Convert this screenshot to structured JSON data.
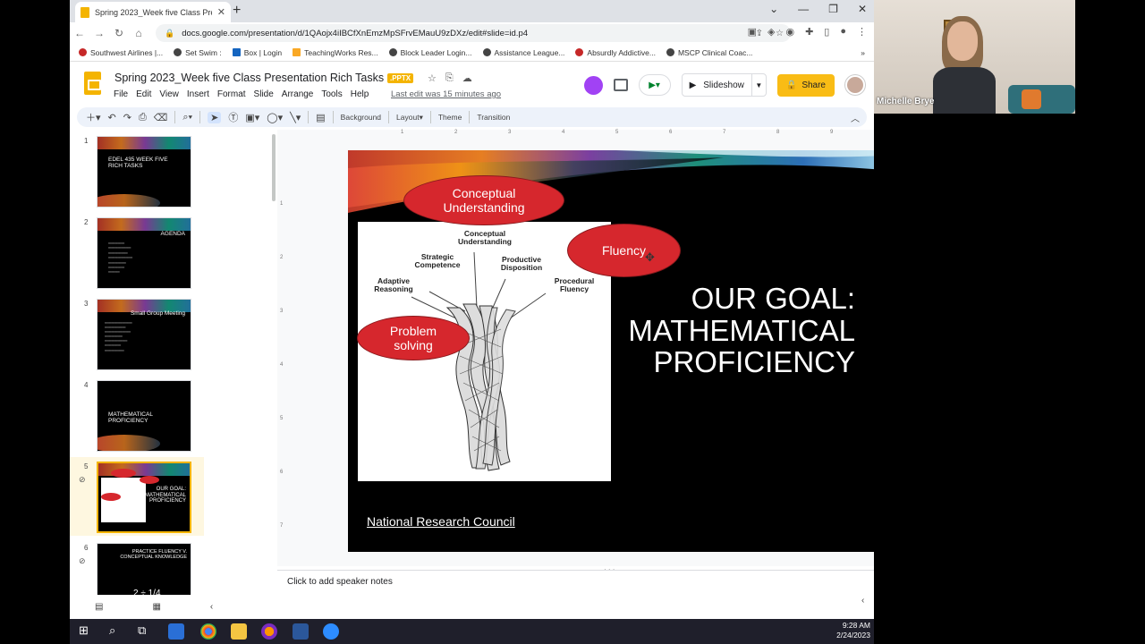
{
  "browser": {
    "tab_title": "Spring 2023_Week five Class Pre",
    "url": "docs.google.com/presentation/d/1QAojx4iIBCfXnEmzMpSFrvEMauU9zDXz/edit#slide=id.p4",
    "bookmarks": [
      {
        "label": "Southwest Airlines |...",
        "icon": "heart-icon"
      },
      {
        "label": "Set Swim :",
        "icon": "globe-icon"
      },
      {
        "label": "Box | Login",
        "icon": "box-icon"
      },
      {
        "label": "TeachingWorks Res...",
        "icon": "folder-icon"
      },
      {
        "label": "Block Leader Login...",
        "icon": "globe-icon"
      },
      {
        "label": "Assistance League...",
        "icon": "globe-icon"
      },
      {
        "label": "Absurdly Addictive...",
        "icon": "pinterest-icon"
      },
      {
        "label": "MSCP Clinical Coac...",
        "icon": "globe-icon"
      }
    ]
  },
  "app": {
    "doc_title": "Spring 2023_Week five Class Presentation Rich Tasks",
    "badge": ".PPTX",
    "menu": [
      "File",
      "Edit",
      "View",
      "Insert",
      "Format",
      "Slide",
      "Arrange",
      "Tools",
      "Help"
    ],
    "last_edit": "Last edit was 15 minutes ago",
    "slideshow_label": "Slideshow",
    "share_label": "Share"
  },
  "toolbar": {
    "background": "Background",
    "layout": "Layout",
    "theme": "Theme",
    "transition": "Transition"
  },
  "filmstrip": [
    {
      "num": "1",
      "title": "EDEL 435 WEEK FIVE RICH TASKS"
    },
    {
      "num": "2",
      "title": "AGENDA"
    },
    {
      "num": "3",
      "title": "Small Group Meeting"
    },
    {
      "num": "4",
      "title": "MATHEMATICAL PROFICIENCY"
    },
    {
      "num": "5",
      "title": "OUR GOAL: MATHEMATICAL PROFICIENCY"
    },
    {
      "num": "6",
      "title": "PRACTICE FLUENCY V. CONCEPTUAL KNOWLEDGE",
      "extra": "2 ÷ 1/4"
    }
  ],
  "slide": {
    "ovals": {
      "conceptual": "Conceptual Understanding",
      "fluency": "Fluency",
      "problem": "Problem solving"
    },
    "diagram_labels": {
      "conceptual": "Conceptual Understanding",
      "strategic": "Strategic Competence",
      "productive": "Productive Disposition",
      "adaptive": "Adaptive Reasoning",
      "procedural": "Procedural Fluency"
    },
    "goal_lines": [
      "OUR GOAL:",
      "MATHEMATICAL",
      "PROFICIENCY"
    ],
    "source": "National Research Council"
  },
  "notes_placeholder": "Click to add speaker notes",
  "webcam": {
    "name": "Michelle Brye"
  },
  "clock": {
    "time": "9:28 AM",
    "date": "2/24/2023"
  },
  "ruler": {
    "h": [
      "1",
      "2",
      "3",
      "4",
      "5",
      "6",
      "7",
      "8",
      "9"
    ],
    "v": [
      "1",
      "2",
      "3",
      "4",
      "5",
      "6",
      "7"
    ]
  }
}
